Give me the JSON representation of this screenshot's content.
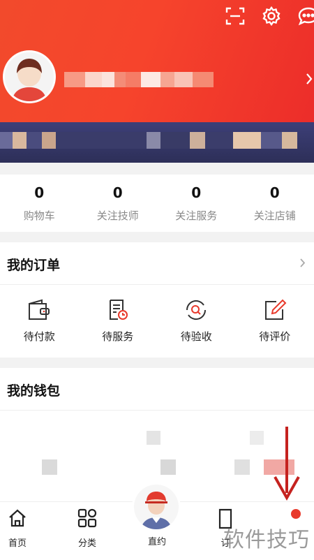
{
  "header": {
    "scan_icon": "scan-icon",
    "settings_icon": "gear-icon",
    "message_icon": "message-icon",
    "avatar_icon": "avatar-icon",
    "colors": {
      "bg_start": "#f24a2c",
      "bg_end": "#ec2d2a"
    }
  },
  "stats": [
    {
      "value": "0",
      "label": "购物车"
    },
    {
      "value": "0",
      "label": "关注技师"
    },
    {
      "value": "0",
      "label": "关注服务"
    },
    {
      "value": "0",
      "label": "关注店铺"
    }
  ],
  "orders": {
    "title": "我的订单",
    "items": [
      {
        "label": "待付款",
        "icon": "wallet-icon"
      },
      {
        "label": "待服务",
        "icon": "document-clock-icon"
      },
      {
        "label": "待验收",
        "icon": "search-circle-icon"
      },
      {
        "label": "待评价",
        "icon": "edit-icon"
      }
    ]
  },
  "wallet": {
    "title": "我的钱包"
  },
  "nav": {
    "items": [
      {
        "label": "首页",
        "icon": "home-icon"
      },
      {
        "label": "分类",
        "icon": "grid-icon"
      },
      {
        "label": "直约",
        "icon": "technician-avatar-icon"
      },
      {
        "label": "订",
        "icon": "document-icon"
      },
      {
        "label": "",
        "icon": "dot-icon"
      }
    ]
  },
  "watermark": "软件技巧",
  "accent": "#e8392b"
}
